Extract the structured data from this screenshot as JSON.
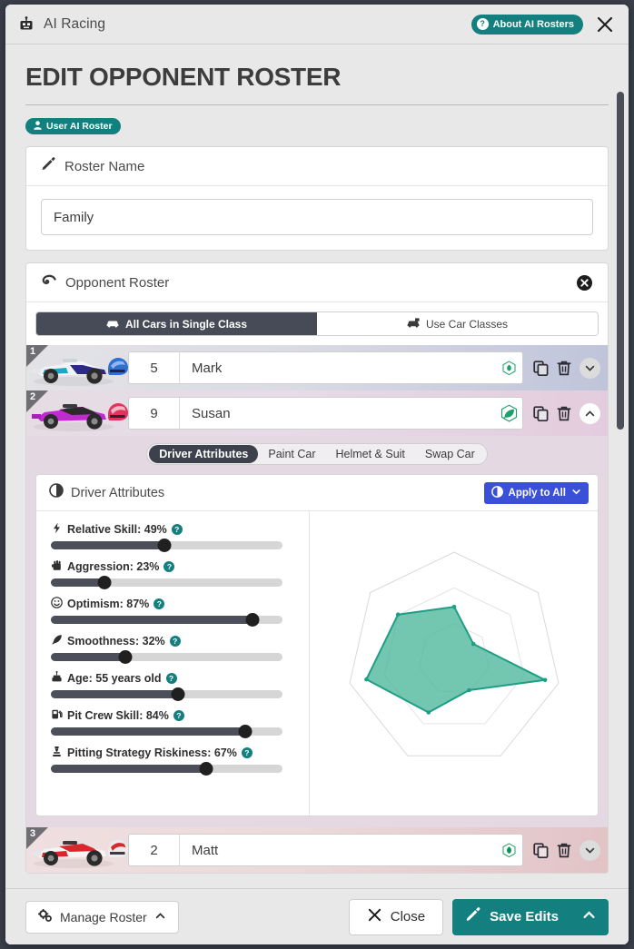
{
  "titlebar": {
    "app_icon": "robot-icon",
    "app_title": "AI Racing",
    "about_label": "About AI Rosters",
    "about_badge": "?",
    "close_icon": "close-icon",
    "accent": "#13807f"
  },
  "page": {
    "title": "EDIT OPPONENT ROSTER",
    "chip_label": "User AI Roster",
    "chip_icon": "user-icon"
  },
  "roster_name_card": {
    "header": "Roster Name",
    "header_icon": "pencil-icon",
    "value": "Family",
    "placeholder": "Roster Name"
  },
  "opponent_card": {
    "header": "Opponent Roster",
    "header_icon": "steering-icon",
    "clear_icon": "clear-circle-icon",
    "segmented": [
      {
        "label": "All Cars in Single Class",
        "icon": "car-icon",
        "active": true
      },
      {
        "label": "Use Car Classes",
        "icon": "car-class-icon",
        "active": false
      }
    ]
  },
  "drivers": [
    {
      "index": "1",
      "number": "5",
      "name": "Mark",
      "car_color": "#1fa5c9",
      "car_color2": "#2b2a8c",
      "helmet_color": "#2f6fd0",
      "helmet_color2": "#8fb8ee",
      "eco_icon": "leaf-icon",
      "eco_color": "#1aa06a",
      "expanded": false,
      "actions": [
        "copy-icon",
        "trash-icon",
        "chevron-down-icon"
      ]
    },
    {
      "index": "2",
      "number": "9",
      "name": "Susan",
      "car_color": "#c02ad0",
      "car_color2": "#2a2a2a",
      "helmet_color": "#e0345c",
      "helmet_color2": "#f7b6c4",
      "eco_icon": "leaf-icon",
      "eco_color": "#1aa06a",
      "expanded": true,
      "actions": [
        "copy-icon",
        "trash-icon",
        "chevron-up-icon"
      ]
    },
    {
      "index": "3",
      "number": "2",
      "name": "Matt",
      "car_color": "#d8282b",
      "car_color2": "#f2f2f2",
      "helmet_color": "#e8e8e8",
      "helmet_color2": "#d8282b",
      "eco_icon": "leaf-icon",
      "eco_color": "#1aa06a",
      "expanded": false,
      "actions": [
        "copy-icon",
        "trash-icon",
        "chevron-down-icon"
      ]
    }
  ],
  "expanded_panel": {
    "tabs": [
      {
        "label": "Driver Attributes",
        "active": true
      },
      {
        "label": "Paint Car",
        "active": false
      },
      {
        "label": "Helmet & Suit",
        "active": false
      },
      {
        "label": "Swap Car",
        "active": false
      }
    ],
    "panel_title": "Driver Attributes",
    "panel_icon": "contrast-icon",
    "apply_label": "Apply to All",
    "apply_icon": "contrast-icon",
    "apply_chevron": "chevron-down-icon",
    "apply_color": "#3a50d8",
    "help_icon": "question-icon"
  },
  "chart_data": {
    "type": "radar",
    "title": "Driver Attributes",
    "axes": [
      "Relative Skill",
      "Aggression",
      "Optimism",
      "Smoothness",
      "Age",
      "Pit Crew Skill",
      "Pitting Strategy Riskiness"
    ],
    "values": [
      49,
      23,
      87,
      32,
      55,
      84,
      67
    ],
    "units": [
      "%",
      "%",
      "%",
      "%",
      "years old",
      "%",
      "%"
    ],
    "range": [
      0,
      100
    ],
    "rings": 3,
    "fill_color": "#4bb79b",
    "stroke_color": "#1f9e86",
    "grid": true,
    "legend": "none"
  },
  "attributes": [
    {
      "icon": "bolt-icon",
      "label": "Relative Skill",
      "display": "Relative Skill: 49%",
      "value": 49,
      "suffix": "%"
    },
    {
      "icon": "fist-icon",
      "label": "Aggression",
      "display": "Aggression: 23%",
      "value": 23,
      "suffix": "%"
    },
    {
      "icon": "smile-icon",
      "label": "Optimism",
      "display": "Optimism: 87%",
      "value": 87,
      "suffix": "%"
    },
    {
      "icon": "feather-icon",
      "label": "Smoothness",
      "display": "Smoothness: 32%",
      "value": 32,
      "suffix": "%"
    },
    {
      "icon": "cake-icon",
      "label": "Age",
      "display": "Age: 55 years old",
      "value": 55,
      "suffix": " years old"
    },
    {
      "icon": "gas-pump-icon",
      "label": "Pit Crew Skill",
      "display": "Pit Crew Skill: 84%",
      "value": 84,
      "suffix": "%"
    },
    {
      "icon": "chess-icon",
      "label": "Pitting Strategy Riskiness",
      "display": "Pitting Strategy Riskiness: 67%",
      "value": 67,
      "suffix": "%"
    }
  ],
  "footer": {
    "manage_label": "Manage Roster",
    "manage_icon": "gears-icon",
    "manage_chevron": "chevron-up-icon",
    "close_label": "Close",
    "close_icon": "x-icon",
    "save_label": "Save Edits",
    "save_icon": "pencil-icon",
    "save_chevron": "chevron-up-icon",
    "save_color": "#13807f"
  }
}
